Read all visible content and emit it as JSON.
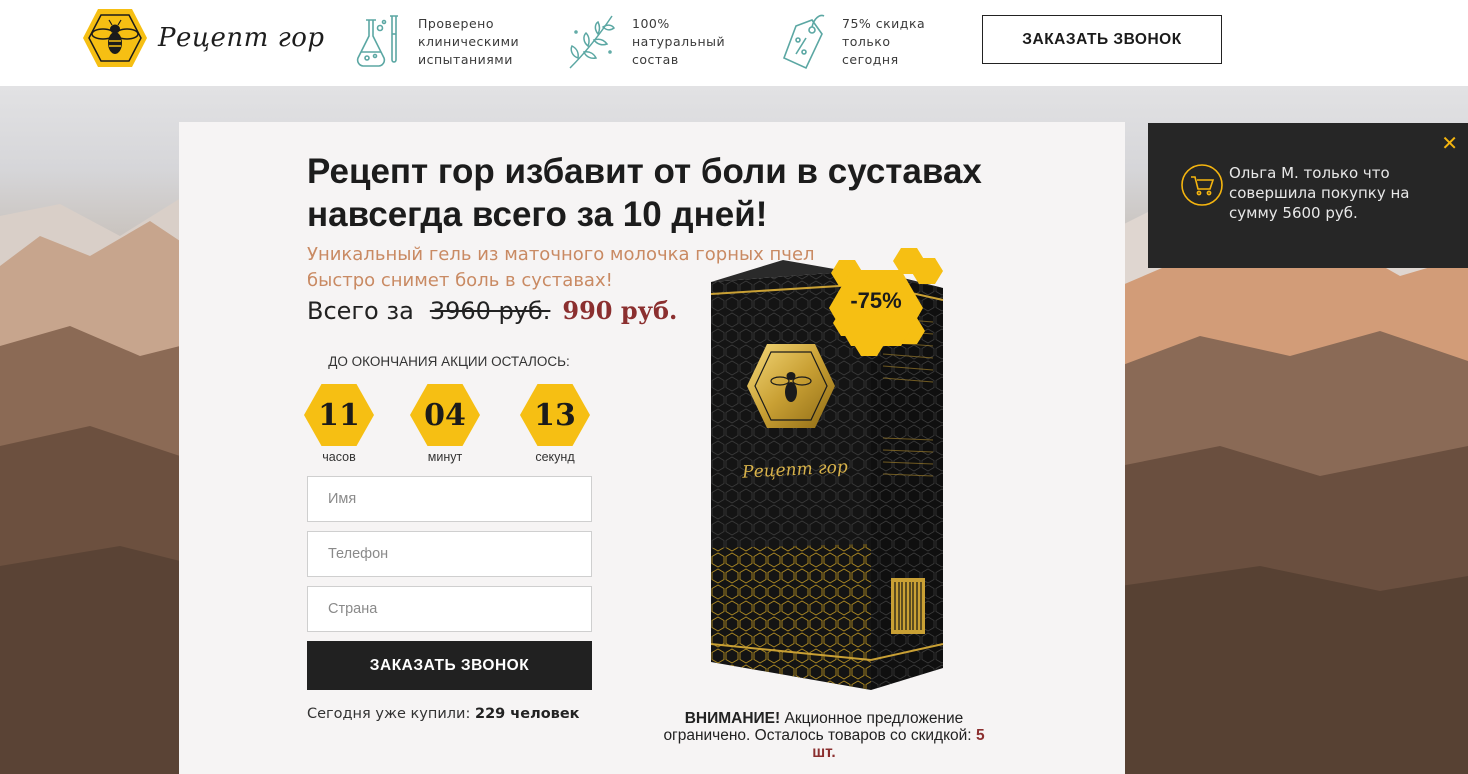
{
  "header": {
    "logo_text": "Рецепт гор",
    "features": [
      {
        "icon": "flask-icon",
        "lines": [
          "Проверено",
          "клиническими",
          "испытаниями"
        ]
      },
      {
        "icon": "herb-icon",
        "lines": [
          "100%",
          "натуральный",
          "состав"
        ]
      },
      {
        "icon": "price-tag-icon",
        "lines": [
          "75% скидка",
          "только",
          "сегодня"
        ]
      }
    ],
    "cta_label": "ЗАКАЗАТЬ ЗВОНОК"
  },
  "offer": {
    "title": "Рецепт гор избавит от боли в суставах навсегда всего за 10 дней!",
    "subtitle": "Уникальный гель из маточного молочка горных пчел быстро снимет боль в суставах!",
    "price_prefix": "Всего за",
    "old_price": "3960 руб.",
    "new_price": "990 руб."
  },
  "timer": {
    "label": "ДО ОКОНЧАНИЯ АКЦИИ ОСТАЛОСЬ:",
    "hours": "11",
    "hours_label": "часов",
    "minutes": "04",
    "minutes_label": "минут",
    "seconds": "13",
    "seconds_label": "секунд"
  },
  "form": {
    "name_placeholder": "Имя",
    "phone_placeholder": "Телефон",
    "country_placeholder": "Страна",
    "submit_label": "ЗАКАЗАТЬ ЗВОНОК",
    "bought_prefix": "Сегодня уже купили:",
    "bought_count": "229 человек"
  },
  "product": {
    "badge": "-75%",
    "box_brand": "Рецепт гор",
    "attention_strong": "ВНИМАНИЕ!",
    "attention_text": "Акционное предложение ограничено. Осталось товаров со скидкой:",
    "attention_count": "5 шт."
  },
  "toast": {
    "text": "Ольга М. только что совершила покупку на сумму 5600 руб.",
    "icon": "cart-icon",
    "close_icon": "close-icon"
  },
  "colors": {
    "accent": "#f6bf13",
    "price_red": "#8b2f2f",
    "subtitle": "#c98a63",
    "dark": "#212121",
    "teal_icons": "#5ba7a3"
  }
}
